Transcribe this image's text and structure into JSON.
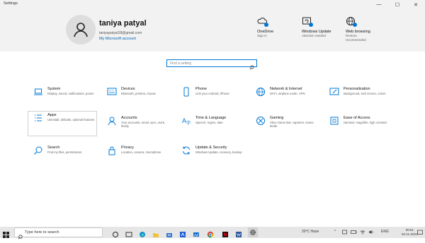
{
  "window": {
    "title": "Settings",
    "minimize": "—",
    "maximize": "☐",
    "close": "✕"
  },
  "user": {
    "name": "taniya patyal",
    "email": "taniyapatyal18@gmail.com",
    "link": "My Microsoft account"
  },
  "header_items": [
    {
      "label": "OneDrive",
      "sub1": "Sign in",
      "sub2": ""
    },
    {
      "label": "Windows Update",
      "sub1": "Attention needed",
      "sub2": ""
    },
    {
      "label": "Web browsing",
      "sub1": "Restore",
      "sub2": "recommended"
    }
  ],
  "search": {
    "placeholder": "Find a setting"
  },
  "tiles": [
    {
      "name": "System",
      "desc": "Display, sound, notifications, power"
    },
    {
      "name": "Devices",
      "desc": "Bluetooth, printers, mouse"
    },
    {
      "name": "Phone",
      "desc": "Link your Android, iPhone"
    },
    {
      "name": "Network & Internet",
      "desc": "Wi-Fi, airplane mode, VPN"
    },
    {
      "name": "Personalization",
      "desc": "Background, lock screen, colors"
    },
    {
      "name": "Apps",
      "desc": "Uninstall, defaults, optional features"
    },
    {
      "name": "Accounts",
      "desc": "Your accounts, email, sync, work, family"
    },
    {
      "name": "Time & Language",
      "desc": "Speech, region, date"
    },
    {
      "name": "Gaming",
      "desc": "Xbox Game Bar, captures, Game Mode"
    },
    {
      "name": "Ease of Access",
      "desc": "Narrator, magnifier, high contrast"
    },
    {
      "name": "Search",
      "desc": "Find my files, permissions"
    },
    {
      "name": "Privacy",
      "desc": "Location, camera, microphone"
    },
    {
      "name": "Update & Security",
      "desc": "Windows Update, recovery, backup"
    }
  ],
  "taskbar": {
    "search_text": "Type here to search",
    "weather": "20°C  Haze",
    "lang": "ENG",
    "time": "00:51",
    "date": "02-11-2021"
  },
  "colors": {
    "accent": "#0078d7",
    "header_bg": "#f2f2f2",
    "taskbar_bg": "#e6e6e6"
  }
}
